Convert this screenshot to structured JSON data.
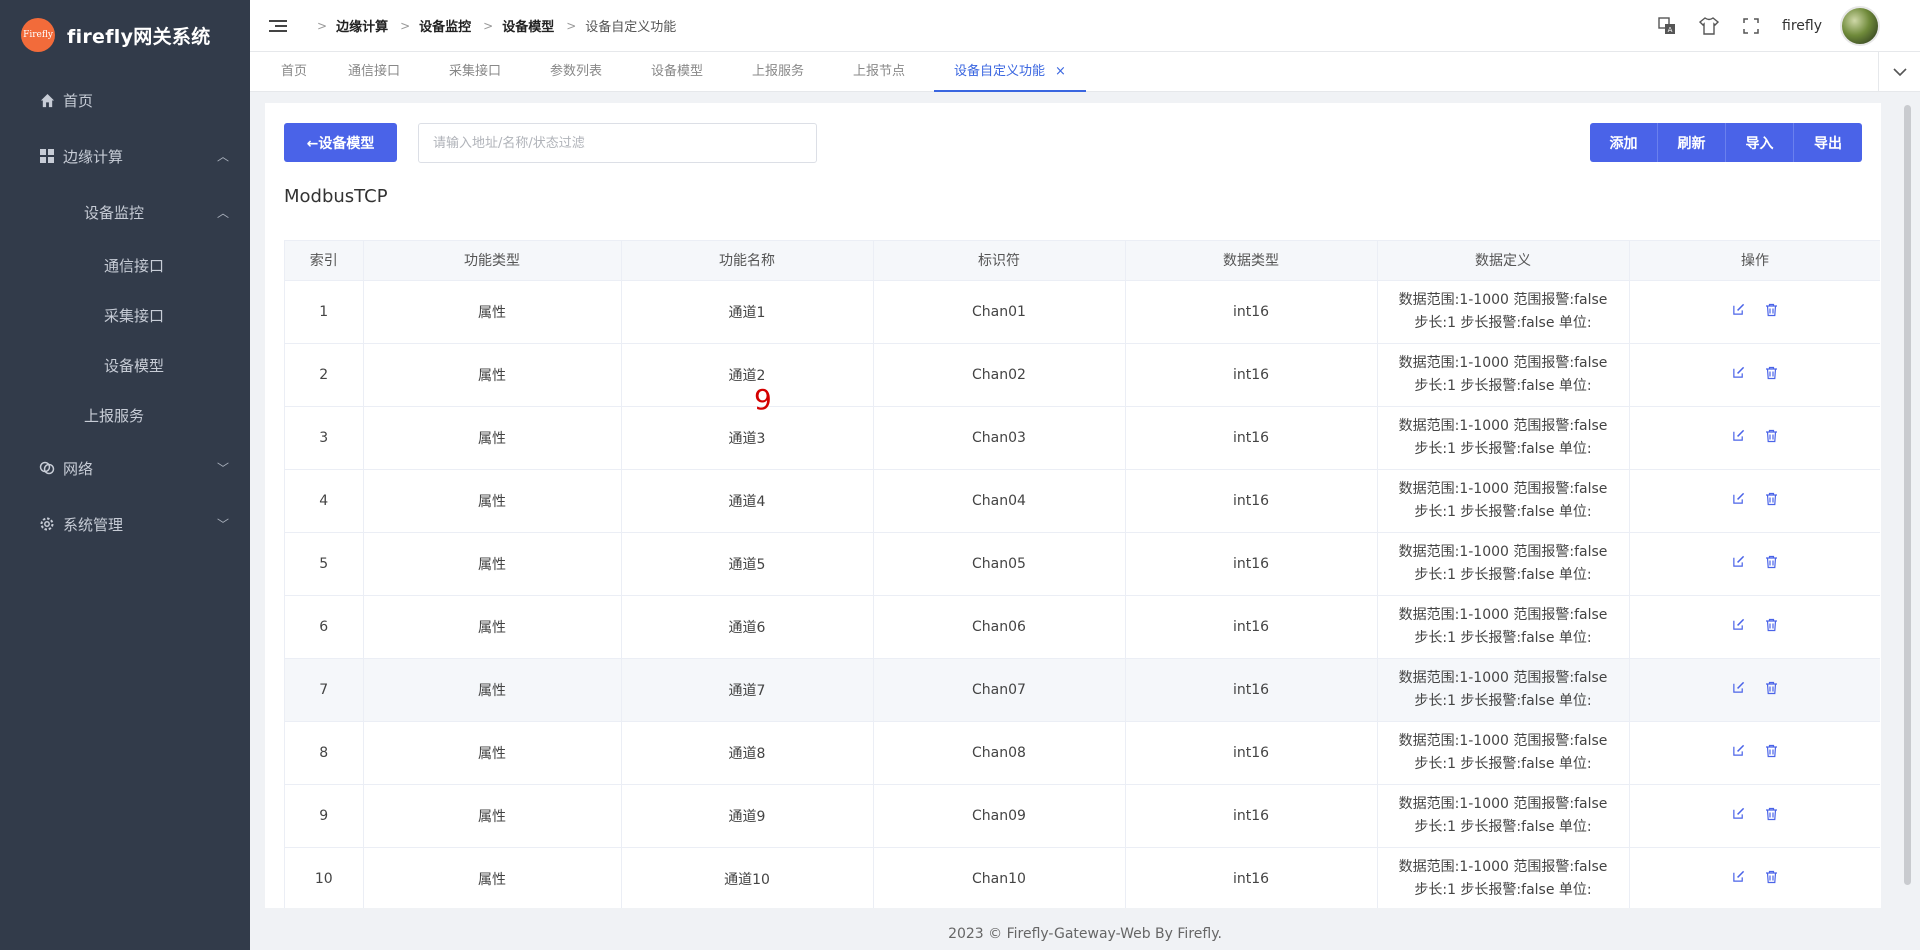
{
  "brand": {
    "logo_text": "Firefly",
    "title": "firefly网关系统"
  },
  "sidebar": {
    "home": "首页",
    "edge": "边缘计算",
    "device_monitor": "设备监控",
    "comm_interface": "通信接口",
    "collect_interface": "采集接口",
    "device_model": "设备模型",
    "report_service": "上报服务",
    "network": "网络",
    "system": "系统管理"
  },
  "breadcrumb": [
    "边缘计算",
    "设备监控",
    "设备模型",
    "设备自定义功能"
  ],
  "user": {
    "name": "firefly"
  },
  "tabs": [
    "首页",
    "通信接口",
    "采集接口",
    "参数列表",
    "设备模型",
    "上报服务",
    "上报节点",
    "设备自定义功能"
  ],
  "toolbar": {
    "back_label": "←设备模型",
    "search_placeholder": "请输入地址/名称/状态过滤",
    "add": "添加",
    "refresh": "刷新",
    "import": "导入",
    "export": "导出"
  },
  "section_title": "ModbusTCP",
  "table": {
    "headers": [
      "索引",
      "功能类型",
      "功能名称",
      "标识符",
      "数据类型",
      "数据定义",
      "操作"
    ],
    "rows": [
      {
        "index": "1",
        "type": "属性",
        "name": "通道1",
        "id": "Chan01",
        "dtype": "int16",
        "def1": "数据范围:1-1000 范围报警:false",
        "def2": "步长:1 步长报警:false 单位:"
      },
      {
        "index": "2",
        "type": "属性",
        "name": "通道2",
        "id": "Chan02",
        "dtype": "int16",
        "def1": "数据范围:1-1000 范围报警:false",
        "def2": "步长:1 步长报警:false 单位:"
      },
      {
        "index": "3",
        "type": "属性",
        "name": "通道3",
        "id": "Chan03",
        "dtype": "int16",
        "def1": "数据范围:1-1000 范围报警:false",
        "def2": "步长:1 步长报警:false 单位:"
      },
      {
        "index": "4",
        "type": "属性",
        "name": "通道4",
        "id": "Chan04",
        "dtype": "int16",
        "def1": "数据范围:1-1000 范围报警:false",
        "def2": "步长:1 步长报警:false 单位:"
      },
      {
        "index": "5",
        "type": "属性",
        "name": "通道5",
        "id": "Chan05",
        "dtype": "int16",
        "def1": "数据范围:1-1000 范围报警:false",
        "def2": "步长:1 步长报警:false 单位:"
      },
      {
        "index": "6",
        "type": "属性",
        "name": "通道6",
        "id": "Chan06",
        "dtype": "int16",
        "def1": "数据范围:1-1000 范围报警:false",
        "def2": "步长:1 步长报警:false 单位:"
      },
      {
        "index": "7",
        "type": "属性",
        "name": "通道7",
        "id": "Chan07",
        "dtype": "int16",
        "def1": "数据范围:1-1000 范围报警:false",
        "def2": "步长:1 步长报警:false 单位:"
      },
      {
        "index": "8",
        "type": "属性",
        "name": "通道8",
        "id": "Chan08",
        "dtype": "int16",
        "def1": "数据范围:1-1000 范围报警:false",
        "def2": "步长:1 步长报警:false 单位:"
      },
      {
        "index": "9",
        "type": "属性",
        "name": "通道9",
        "id": "Chan09",
        "dtype": "int16",
        "def1": "数据范围:1-1000 范围报警:false",
        "def2": "步长:1 步长报警:false 单位:"
      },
      {
        "index": "10",
        "type": "属性",
        "name": "通道10",
        "id": "Chan10",
        "dtype": "int16",
        "def1": "数据范围:1-1000 范围报警:false",
        "def2": "步长:1 步长报警:false 单位:"
      }
    ]
  },
  "overlay_mark": "9",
  "footer": "2023 © Firefly-Gateway-Web By Firefly.",
  "colors": {
    "sidebar_bg": "#323b4a",
    "primary": "#4a63e8",
    "tab_active": "#3a66e0",
    "logo": "#f26b3a",
    "overlay": "#d40000"
  },
  "icons": [
    "home-icon",
    "grid-icon",
    "network-icon",
    "gear-icon",
    "translate-icon",
    "shirt-icon",
    "fullscreen-icon",
    "edit-icon",
    "trash-icon"
  ]
}
